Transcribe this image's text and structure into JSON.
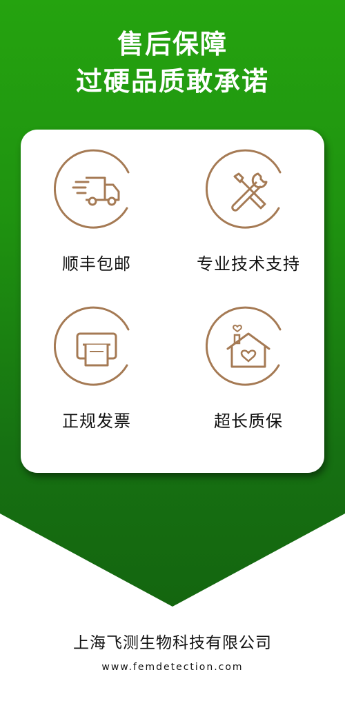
{
  "header": {
    "title_line1": "售后保障",
    "title_line2": "过硬品质敢承诺"
  },
  "features": [
    {
      "label": "顺丰包邮",
      "icon": "delivery-truck-icon"
    },
    {
      "label": "专业技术支持",
      "icon": "tools-icon"
    },
    {
      "label": "正规发票",
      "icon": "invoice-printer-icon"
    },
    {
      "label": "超长质保",
      "icon": "house-heart-icon"
    }
  ],
  "footer": {
    "company": "上海飞测生物科技有限公司",
    "website": "www.femdetection.com"
  },
  "colors": {
    "green_top": "#25a30f",
    "green_bottom": "#14660f",
    "icon_brown": "#a57a54",
    "card_bg": "#ffffff"
  }
}
